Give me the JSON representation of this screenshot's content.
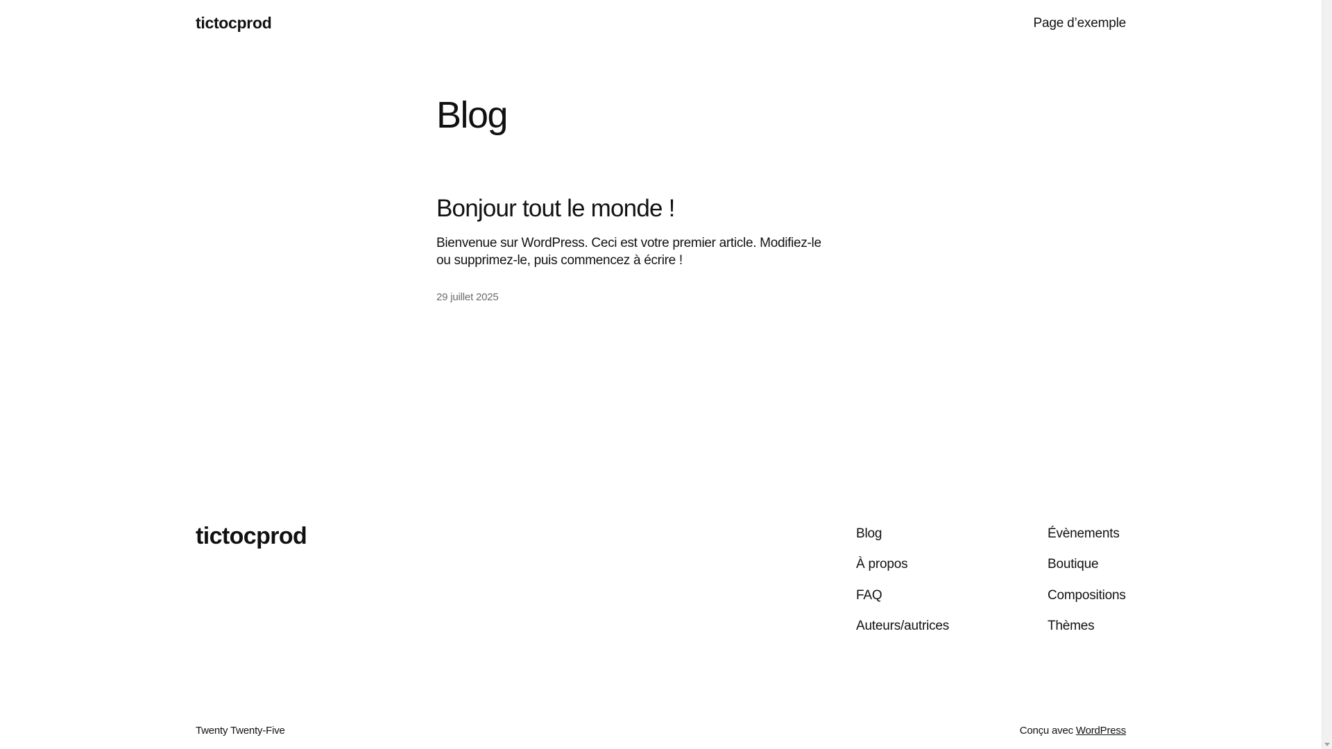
{
  "header": {
    "site_title": "tictocprod",
    "nav_item": "Page d’exemple"
  },
  "main": {
    "page_title": "Blog",
    "post": {
      "title": "Bonjour tout le monde !",
      "excerpt": "Bienvenue sur WordPress. Ceci est votre premier article. Modifiez-le ou supprimez-le, puis commencez à écrire !",
      "date": "29 juillet 2025"
    }
  },
  "footer": {
    "site_title": "tictocprod",
    "nav_col1": [
      "Blog",
      "À propos",
      "FAQ",
      "Auteurs/autrices"
    ],
    "nav_col2": [
      "Évènements",
      "Boutique",
      "Compositions",
      "Thèmes"
    ],
    "credit_left": "Twenty Twenty-Five",
    "credit_right_prefix": "Conçu avec ",
    "credit_right_link": "WordPress"
  }
}
